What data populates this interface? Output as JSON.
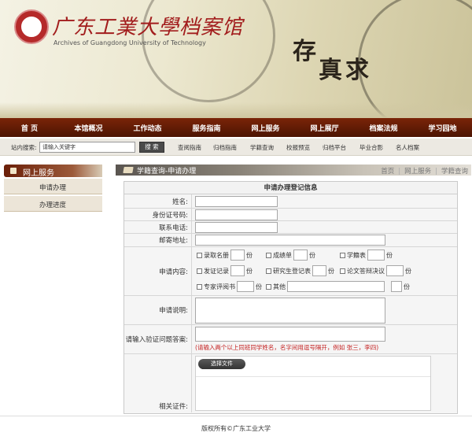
{
  "header": {
    "university_cn": "广东工業大學档案馆",
    "university_en": "Archives of Guangdong University of Technology",
    "slogan_a": "存",
    "slogan_b": "真求"
  },
  "nav": {
    "items": [
      "首 页",
      "本馆概况",
      "工作动态",
      "服务指南",
      "网上服务",
      "网上展厅",
      "档案法规",
      "学习园地"
    ]
  },
  "search": {
    "label": "站内搜索:",
    "placeholder": "请输入关键字",
    "button": "搜 索"
  },
  "quick_links": [
    "查阅指南",
    "归档指南",
    "学籍查询",
    "校报预览",
    "归档平台",
    "毕业合影",
    "名人档案"
  ],
  "sidebar": {
    "title": "网上服务",
    "items": [
      "申请办理",
      "办理进度"
    ]
  },
  "main": {
    "title": "学籍查询-申请办理",
    "breadcrumb": [
      "首页",
      "网上服务",
      "学籍查询"
    ]
  },
  "form": {
    "title": "申请办理登记信息",
    "labels": {
      "name": "姓名:",
      "id_number": "身份证号码:",
      "phone": "联系电话:",
      "address": "邮寄地址:",
      "content": "申请内容:",
      "description": "申请说明:",
      "verify": "请输入验证问题答案:",
      "attachments": "相关证件:"
    },
    "options": [
      {
        "label": "录取名册",
        "unit": "份"
      },
      {
        "label": "成绩单",
        "unit": "份"
      },
      {
        "label": "学籍表",
        "unit": "份"
      },
      {
        "label": "发证记录",
        "unit": "份"
      },
      {
        "label": "研究生登记表",
        "unit": "份"
      },
      {
        "label": "论文答辩决议",
        "unit": "份"
      },
      {
        "label": "专家评阅书",
        "unit": "份"
      },
      {
        "label": "其他",
        "unit": "份"
      }
    ],
    "verify_hint": "(请输入两个以上同班同学姓名，名字间用逗号隔开，例如 张三，李四)",
    "upload_button": "选择文件"
  },
  "footer": {
    "text": "版权所有©广东工业大学"
  }
}
